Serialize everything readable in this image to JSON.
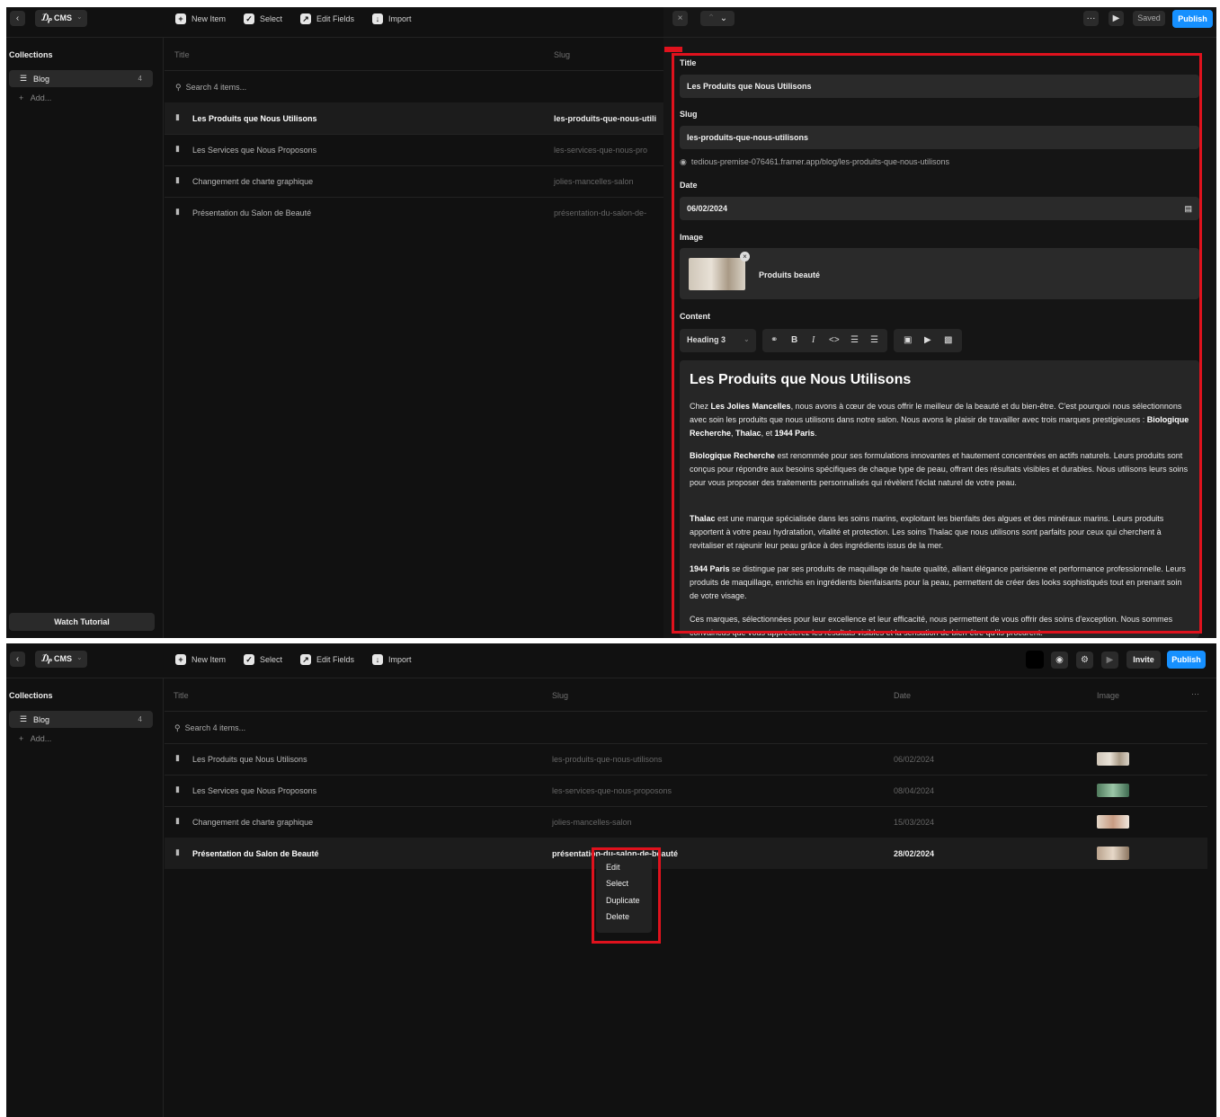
{
  "app": {
    "cms_label": "CMS",
    "toolbar": {
      "new_item": "New Item",
      "select": "Select",
      "edit_fields": "Edit Fields",
      "import": "Import"
    },
    "sidebar": {
      "collections_title": "Collections",
      "collection_name": "Blog",
      "collection_count": "4",
      "add_label": "Add...",
      "watch_tutorial": "Watch Tutorial"
    },
    "columns": {
      "title": "Title",
      "slug": "Slug",
      "date": "Date",
      "image": "Image"
    },
    "search_placeholder": "Search 4 items...",
    "more": "···"
  },
  "items": [
    {
      "title": "Les Produits que Nous Utilisons",
      "slug": "les-produits-que-nous-utilisons",
      "slug_short": "les-produits-que-nous-utili",
      "date": "06/02/2024"
    },
    {
      "title": "Les Services que Nous Proposons",
      "slug": "les-services-que-nous-proposons",
      "slug_short": "les-services-que-nous-pro",
      "date": "08/04/2024"
    },
    {
      "title": "Changement de charte graphique",
      "slug": "jolies-mancelles-salon",
      "slug_short": "jolies-mancelles-salon",
      "date": "15/03/2024"
    },
    {
      "title": "Présentation du Salon de Beauté",
      "slug": "présentation-du-salon-de-beauté",
      "slug_short": "présentation-du-salon-de-",
      "date": "28/02/2024"
    }
  ],
  "editor": {
    "saved": "Saved",
    "publish": "Publish",
    "title_label": "Title",
    "title_value": "Les Produits que Nous Utilisons",
    "slug_label": "Slug",
    "slug_value": "les-produits-que-nous-utilisons",
    "url": "tedious-premise-076461.framer.app/blog/les-produits-que-nous-utilisons",
    "date_label": "Date",
    "date_value": "06/02/2024",
    "image_label": "Image",
    "image_name": "Produits beauté",
    "content_label": "Content",
    "block_type": "Heading 3",
    "heading": "Les Produits que Nous Utilisons",
    "p1": [
      "Chez ",
      "Les Jolies Mancelles",
      ", nous avons à cœur de vous offrir le meilleur de la beauté et du bien-être. C'est pourquoi nous sélectionnons avec soin les produits que nous utilisons dans notre salon. Nous avons le plaisir de travailler avec trois marques prestigieuses : ",
      "Biologique Recherche",
      ", ",
      "Thalac",
      ", et ",
      "1944 Paris",
      "."
    ],
    "p2": [
      "Biologique Recherche",
      " est renommée pour ses formulations innovantes et hautement concentrées en actifs naturels. Leurs produits sont conçus pour répondre aux besoins spécifiques de chaque type de peau, offrant des résultats visibles et durables. Nous utilisons leurs soins pour vous proposer des traitements personnalisés qui révèlent l'éclat naturel de votre peau."
    ],
    "p3": [
      "Thalac",
      " est une marque spécialisée dans les soins marins, exploitant les bienfaits des algues et des minéraux marins. Leurs produits apportent à votre peau hydratation, vitalité et protection. Les soins Thalac que nous utilisons sont parfaits pour ceux qui cherchent à revitaliser et rajeunir leur peau grâce à des ingrédients issus de la mer."
    ],
    "p4": [
      "1944 Paris",
      " se distingue par ses produits de maquillage de haute qualité, alliant élégance parisienne et performance professionnelle. Leurs produits de maquillage, enrichis en ingrédients bienfaisants pour la peau, permettent de créer des looks sophistiqués tout en prenant soin de votre visage."
    ],
    "p5": "Ces marques, sélectionnées pour leur excellence et leur efficacité, nous permettent de vous offrir des soins d'exception. Nous sommes convaincus que vous apprécierez les résultats visibles et la sensation de bien-être qu'ils procurent."
  },
  "bottom": {
    "invite": "Invite",
    "publish": "Publish"
  },
  "context_menu": [
    "Edit",
    "Select",
    "Duplicate",
    "Delete"
  ],
  "colors": {
    "highlight": "#e0121d",
    "accent": "#1690ff",
    "background": "#111111"
  }
}
